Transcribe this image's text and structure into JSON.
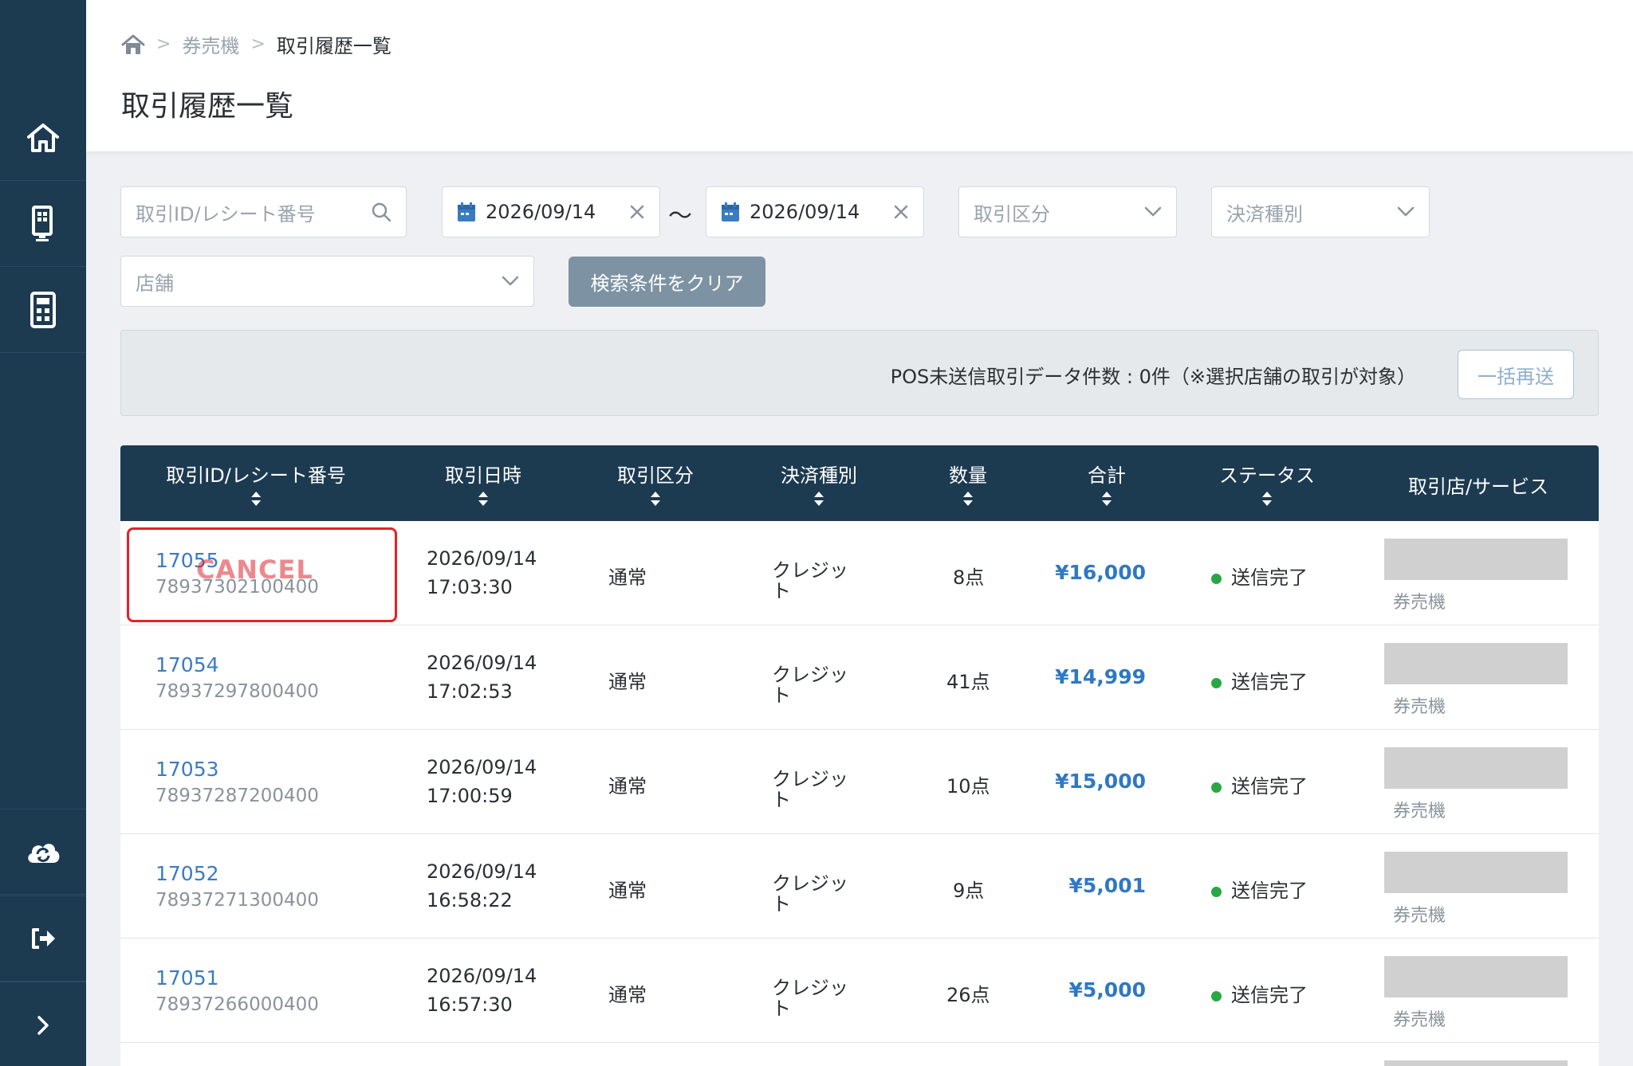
{
  "breadcrumb": {
    "parent": "券売機",
    "current": "取引履歴一覧"
  },
  "page_title": "取引履歴一覧",
  "filters": {
    "search_placeholder": "取引ID/レシート番号",
    "date_from": "2026/09/14",
    "date_to": "2026/09/14",
    "range_sep": "〜",
    "transaction_type_placeholder": "取引区分",
    "payment_type_placeholder": "決済種別",
    "store_placeholder": "店舗",
    "clear_label": "検索条件をクリア"
  },
  "pos": {
    "text": "POS未送信取引データ件数 : 0件（※選択店舗の取引が対象）",
    "resend_label": "一括再送"
  },
  "table": {
    "headers": [
      "取引ID/レシート番号",
      "取引日時",
      "取引区分",
      "決済種別",
      "数量",
      "合計",
      "ステータス",
      "取引店/サービス"
    ],
    "rows": [
      {
        "id": "17055",
        "receipt": "78937302100400",
        "date": "2026/09/14",
        "time": "17:03:30",
        "type": "通常",
        "payment_l1": "クレジッ",
        "payment_l2": "ト",
        "qty": "8点",
        "total": "¥16,000",
        "status": "送信完了",
        "store": "券売機",
        "badge": "CANCEL"
      },
      {
        "id": "17054",
        "receipt": "78937297800400",
        "date": "2026/09/14",
        "time": "17:02:53",
        "type": "通常",
        "payment_l1": "クレジッ",
        "payment_l2": "ト",
        "qty": "41点",
        "total": "¥14,999",
        "status": "送信完了",
        "store": "券売機"
      },
      {
        "id": "17053",
        "receipt": "78937287200400",
        "date": "2026/09/14",
        "time": "17:00:59",
        "type": "通常",
        "payment_l1": "クレジッ",
        "payment_l2": "ト",
        "qty": "10点",
        "total": "¥15,000",
        "status": "送信完了",
        "store": "券売機"
      },
      {
        "id": "17052",
        "receipt": "78937271300400",
        "date": "2026/09/14",
        "time": "16:58:22",
        "type": "通常",
        "payment_l1": "クレジッ",
        "payment_l2": "ト",
        "qty": "9点",
        "total": "¥5,001",
        "status": "送信完了",
        "store": "券売機"
      },
      {
        "id": "17051",
        "receipt": "78937266000400",
        "date": "2026/09/14",
        "time": "16:57:30",
        "type": "通常",
        "payment_l1": "クレジッ",
        "payment_l2": "ト",
        "qty": "26点",
        "total": "¥5,000",
        "status": "送信完了",
        "store": "券売機"
      }
    ]
  },
  "colors": {
    "sidebar": "#1c3a50",
    "accent": "#3a7cc2",
    "status_ok": "#29a745",
    "cancel": "#e8202a"
  },
  "sidebar_icons": [
    "home-icon",
    "kiosk-icon",
    "calculator-icon",
    "cloud-sync-icon",
    "logout-icon",
    "chevron-right-icon"
  ]
}
